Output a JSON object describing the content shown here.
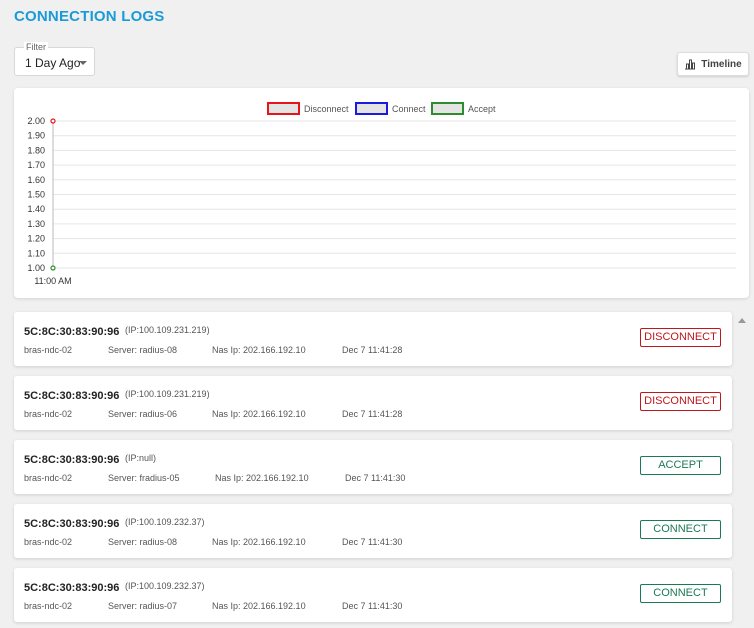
{
  "page": {
    "title": "CONNECTION LOGS"
  },
  "filter": {
    "label": "Filter",
    "value": "1 Day Ago"
  },
  "timeline_button": {
    "label": "Timeline",
    "icon": "bar-chart-icon"
  },
  "colors": {
    "accent": "#1a9bd7",
    "disconnect": "#e8141b",
    "connect": "#1a1ae0",
    "accept": "#2e8b2e",
    "status_disconnect": "#c0161c",
    "status_ok": "#1b7a55"
  },
  "chart_data": {
    "type": "line",
    "legend": [
      "Disconnect",
      "Connect",
      "Accept"
    ],
    "legend_position": "top-center",
    "x": [
      "11:00 AM"
    ],
    "series": [
      {
        "name": "Disconnect",
        "values": [
          2.0
        ]
      },
      {
        "name": "Connect",
        "values": []
      },
      {
        "name": "Accept",
        "values": [
          1.0
        ]
      }
    ],
    "ylim": [
      1.0,
      2.0
    ],
    "y_ticks": [
      "2.00",
      "1.90",
      "1.80",
      "1.70",
      "1.60",
      "1.50",
      "1.40",
      "1.30",
      "1.20",
      "1.10",
      "1.00"
    ],
    "grid": true
  },
  "logs": [
    {
      "mac": "5C:8C:30:83:90:96",
      "ip": "(IP:100.109.231.219)",
      "host": "bras-ndc-02",
      "server": "Server: radius-08",
      "nas": "Nas Ip: 202.166.192.10",
      "time": "Dec 7 11:41:28",
      "status": "DISCONNECT"
    },
    {
      "mac": "5C:8C:30:83:90:96",
      "ip": "(IP:100.109.231.219)",
      "host": "bras-ndc-02",
      "server": "Server: radius-06",
      "nas": "Nas Ip: 202.166.192.10",
      "time": "Dec 7 11:41:28",
      "status": "DISCONNECT"
    },
    {
      "mac": "5C:8C:30:83:90:96",
      "ip": "(IP:null)",
      "host": "bras-ndc-02",
      "server": "Server: fradius-05",
      "nas": "Nas Ip: 202.166.192.10",
      "time": "Dec 7 11:41:30",
      "status": "ACCEPT"
    },
    {
      "mac": "5C:8C:30:83:90:96",
      "ip": "(IP:100.109.232.37)",
      "host": "bras-ndc-02",
      "server": "Server: radius-08",
      "nas": "Nas Ip: 202.166.192.10",
      "time": "Dec 7 11:41:30",
      "status": "CONNECT"
    },
    {
      "mac": "5C:8C:30:83:90:96",
      "ip": "(IP:100.109.232.37)",
      "host": "bras-ndc-02",
      "server": "Server: radius-07",
      "nas": "Nas Ip: 202.166.192.10",
      "time": "Dec 7 11:41:30",
      "status": "CONNECT"
    }
  ]
}
